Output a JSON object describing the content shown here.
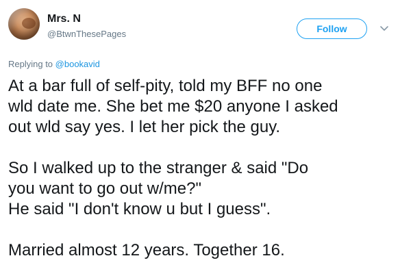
{
  "author": {
    "name": "Mrs. N",
    "handle": "@BtwnThesePages"
  },
  "follow_button": {
    "label": "Follow"
  },
  "icons": {
    "avatar": "profile-photo",
    "menu": "chevron-down-icon"
  },
  "reply": {
    "prefix": "Replying to",
    "mention": "@bookavid"
  },
  "tweet": {
    "lines": [
      "At a bar full of self-pity, told my BFF no one",
      "wld date me. She bet me $20 anyone I asked",
      "out wld say yes. I let her pick the guy.",
      "So I walked up to the stranger & said \"Do",
      "you want to go out w/me?\"",
      "He said \"I don't know u but I guess\".",
      "Married almost 12 years. Together 16."
    ]
  },
  "colors": {
    "accent": "#1da1f2",
    "mention": "#1b95e0",
    "secondary_text": "#657786",
    "primary_text": "#14171a"
  }
}
